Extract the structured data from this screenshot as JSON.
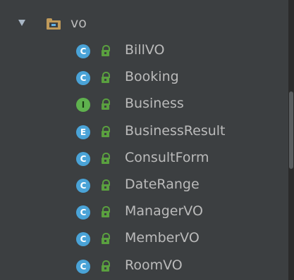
{
  "tree": {
    "folder": {
      "label": "vo",
      "expanded": true,
      "icon": "package-folder-icon"
    },
    "items": [
      {
        "label": "BillVO",
        "kind": "C"
      },
      {
        "label": "Booking",
        "kind": "C"
      },
      {
        "label": "Business",
        "kind": "I"
      },
      {
        "label": "BusinessResult",
        "kind": "E"
      },
      {
        "label": "ConsultForm",
        "kind": "C"
      },
      {
        "label": "DateRange",
        "kind": "C"
      },
      {
        "label": "ManagerVO",
        "kind": "C"
      },
      {
        "label": "MemberVO",
        "kind": "C"
      },
      {
        "label": "RoomVO",
        "kind": "C"
      }
    ]
  },
  "colors": {
    "background": "#3c3f41",
    "text": "#bbbbbb",
    "class_badge": "#4aa3d7",
    "interface_badge": "#5fb24e",
    "lock": "#5aa03f",
    "folder": "#c09a5a"
  }
}
